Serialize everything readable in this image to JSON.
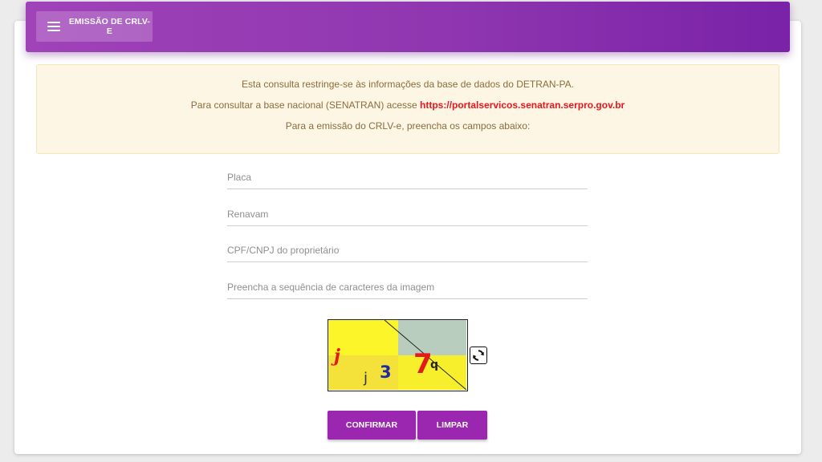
{
  "header": {
    "menu_label": "EMISSÃO DE CRLV-E",
    "menu_icon": "hamburger-menu-icon",
    "gradient": [
      "#a042b8",
      "#7a22a8"
    ]
  },
  "notice": {
    "line1": "Esta consulta restringe-se às informações da base de dados do DETRAN-PA.",
    "line2_prefix": "Para consultar a base nacional (SENATRAN) acesse ",
    "line2_link": "https://portalservicos.senatran.serpro.gov.br",
    "line3": "Para a emissão do CRLV-e, preencha os campos abaixo:",
    "text_color": "#8a6d3b",
    "link_color": "#e8161c",
    "background": "#fdf6e4"
  },
  "form": {
    "placa": {
      "placeholder": "Placa",
      "value": ""
    },
    "renavam": {
      "placeholder": "Renavam",
      "value": ""
    },
    "cpf": {
      "placeholder": "CPF/CNPJ do proprietário",
      "value": ""
    },
    "captcha_input": {
      "placeholder": "Preencha a sequência de caracteres da imagem",
      "value": ""
    }
  },
  "captcha": {
    "chars": [
      "j",
      "j",
      "3",
      "7",
      "q"
    ],
    "refresh_icon": "refresh-icon"
  },
  "buttons": {
    "confirmar": "CONFIRMAR",
    "limpar": "LIMPAR",
    "color": "#9b27b0"
  }
}
